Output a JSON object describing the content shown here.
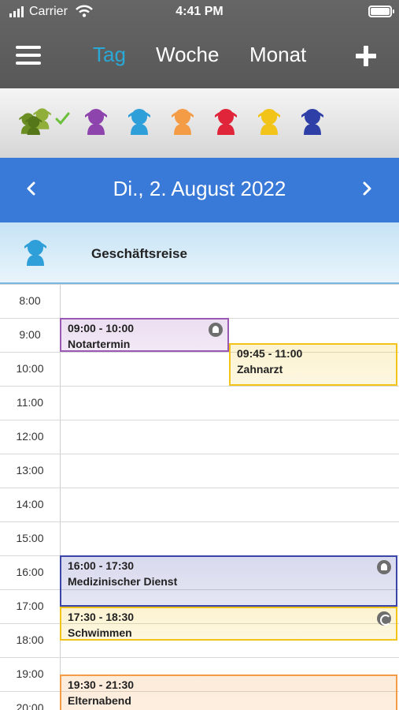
{
  "status": {
    "carrier": "Carrier",
    "time": "4:41 PM"
  },
  "nav": {
    "tabs": [
      {
        "label": "Tag",
        "active": true
      },
      {
        "label": "Woche",
        "active": false
      },
      {
        "label": "Monat",
        "active": false
      }
    ]
  },
  "people": [
    {
      "name": "group-avatar-icon",
      "color": "#6b8e23",
      "selected": true
    },
    {
      "name": "person-avatar-icon",
      "color": "#8e44ad"
    },
    {
      "name": "person-avatar-icon",
      "color": "#2e9fd8"
    },
    {
      "name": "person-avatar-icon",
      "color": "#f39c45"
    },
    {
      "name": "person-avatar-icon",
      "color": "#e0243a"
    },
    {
      "name": "person-avatar-icon",
      "color": "#f2c318"
    },
    {
      "name": "person-avatar-icon",
      "color": "#2f3fa8"
    }
  ],
  "date_header": {
    "date": "Di., 2. August 2022"
  },
  "all_day": {
    "title": "Geschäftsreise",
    "person_color": "#2e9fd8"
  },
  "hours": [
    "8:00",
    "9:00",
    "10:00",
    "11:00",
    "12:00",
    "13:00",
    "14:00",
    "15:00",
    "16:00",
    "17:00",
    "18:00",
    "19:00",
    "20:00"
  ],
  "events": [
    {
      "time": "09:00 - 10:00",
      "title": "Notartermin",
      "color": "#9b59b6",
      "badge": "note-icon"
    },
    {
      "time": "09:45 - 11:00",
      "title": "Zahnarzt",
      "color": "#f2c318",
      "badge": ""
    },
    {
      "time": "16:00 - 17:30",
      "title": "Medizinischer Dienst",
      "color": "#3b45a8",
      "badge": "note-icon"
    },
    {
      "time": "17:30 - 18:30",
      "title": "Schwimmen",
      "color": "#f2c318",
      "badge": "repeat-icon"
    },
    {
      "time": "19:30 - 21:30",
      "title": "Elternabend",
      "color": "#f39c45",
      "badge": ""
    }
  ]
}
